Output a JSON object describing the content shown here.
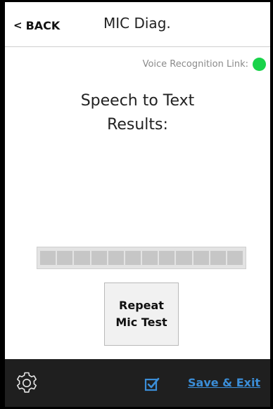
{
  "header": {
    "back_label": "BACK",
    "title": "MIC Diag."
  },
  "status": {
    "label": "Voice Recognition Link:",
    "state_color": "#19d34a"
  },
  "main": {
    "title_line1": "Speech to Text",
    "title_line2": "Results:",
    "result_text": ""
  },
  "meter": {
    "segments": 12,
    "level": 0
  },
  "repeat_button": {
    "line1": "Repeat",
    "line2": "Mic Test"
  },
  "footer": {
    "settings_icon": "gear-icon",
    "check_icon": "checkbox-checked-icon",
    "save_label": "Save & Exit",
    "accent_color": "#3b8ed8"
  }
}
